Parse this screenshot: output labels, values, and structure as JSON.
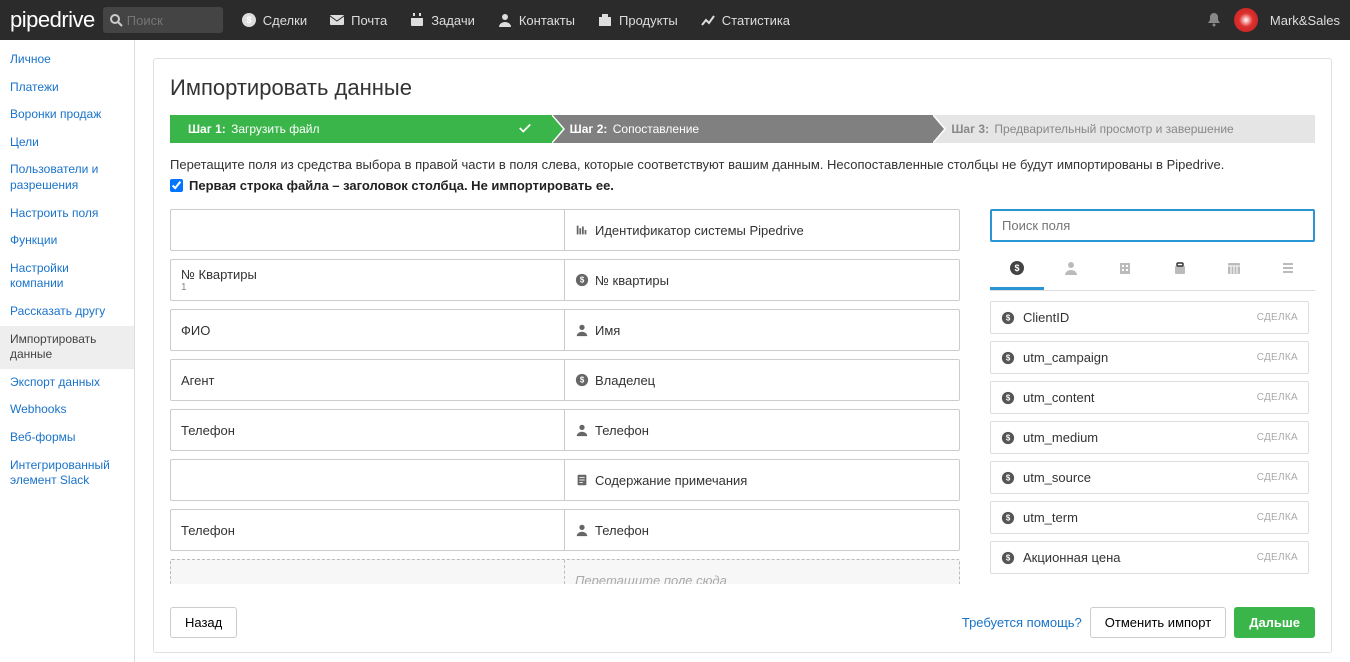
{
  "topbar": {
    "logo": "pipedrive",
    "search_placeholder": "Поиск",
    "nav": [
      {
        "label": "Сделки"
      },
      {
        "label": "Почта"
      },
      {
        "label": "Задачи"
      },
      {
        "label": "Контакты"
      },
      {
        "label": "Продукты"
      },
      {
        "label": "Статистика"
      }
    ],
    "user": "Mark&Sales"
  },
  "sidebar": {
    "items": [
      {
        "label": "Личное"
      },
      {
        "label": "Платежи"
      },
      {
        "label": "Воронки продаж"
      },
      {
        "label": "Цели"
      },
      {
        "label": "Пользователи и разрешения"
      },
      {
        "label": "Настроить поля"
      },
      {
        "label": "Функции"
      },
      {
        "label": "Настройки компании"
      },
      {
        "label": "Рассказать другу"
      },
      {
        "label": "Импортировать данные",
        "active": true
      },
      {
        "label": "Экспорт данных"
      },
      {
        "label": "Webhooks"
      },
      {
        "label": "Веб-формы"
      },
      {
        "label": "Интегрированный элемент Slack"
      }
    ]
  },
  "page": {
    "title": "Импортировать данные",
    "steps": [
      {
        "label": "Шаг 1:",
        "text": "Загрузить файл"
      },
      {
        "label": "Шаг 2:",
        "text": "Сопоставление"
      },
      {
        "label": "Шаг 3:",
        "text": "Предварительный просмотр и завершение"
      }
    ],
    "instruction": "Перетащите поля из средства выбора в правой части в поля слева, которые соответствуют вашим данным. Несопоставленные столбцы не будут импортированы в Pipedrive.",
    "first_row_label": "Первая строка файла – заголовок столбца. Не импортировать ее.",
    "drag_placeholder": "Перетащите поле сюда"
  },
  "mapping": {
    "rows": [
      {
        "src": "",
        "sample": "",
        "dst": "Идентификатор системы Pipedrive",
        "icon": "bars"
      },
      {
        "src": "№ Квартиры",
        "sample": "1",
        "dst": "№ квартиры",
        "icon": "dollar"
      },
      {
        "src": "ФИО",
        "sample": "",
        "dst": "Имя",
        "icon": "person"
      },
      {
        "src": "Агент",
        "sample": "",
        "dst": "Владелец",
        "icon": "dollar"
      },
      {
        "src": "Телефон",
        "sample": "",
        "dst": "Телефон",
        "icon": "person"
      },
      {
        "src": "",
        "sample": "",
        "dst": "Содержание примечания",
        "icon": "note"
      },
      {
        "src": "Телефон",
        "sample": "",
        "dst": "Телефон",
        "icon": "person"
      }
    ]
  },
  "picker": {
    "search_placeholder": "Поиск поля",
    "fields": [
      {
        "label": "ClientID",
        "tag": "СДЕЛКА"
      },
      {
        "label": "utm_campaign",
        "tag": "СДЕЛКА"
      },
      {
        "label": "utm_content",
        "tag": "СДЕЛКА"
      },
      {
        "label": "utm_medium",
        "tag": "СДЕЛКА"
      },
      {
        "label": "utm_source",
        "tag": "СДЕЛКА"
      },
      {
        "label": "utm_term",
        "tag": "СДЕЛКА"
      },
      {
        "label": "Акционная цена",
        "tag": "СДЕЛКА"
      }
    ]
  },
  "footer": {
    "back": "Назад",
    "help": "Требуется помощь?",
    "cancel": "Отменить импорт",
    "next": "Дальше"
  }
}
